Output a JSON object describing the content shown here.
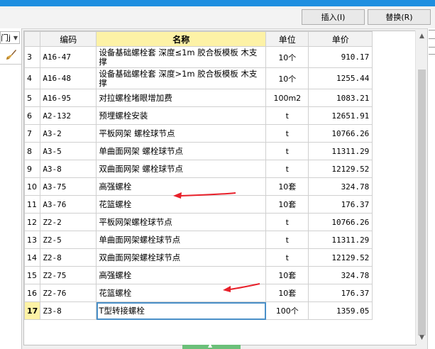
{
  "toolbar": {
    "insert_label": "插入(I)",
    "replace_label": "替换(R)"
  },
  "left_panel": {
    "combo_text": "门j"
  },
  "table": {
    "headers": {
      "row_num": "",
      "code": "编码",
      "name": "名称",
      "unit": "单位",
      "price": "单价"
    },
    "rows": [
      {
        "n": "3",
        "code": "A16-47",
        "name": "设备基础螺栓套 深度≤1m 胶合板模板 木支撑",
        "unit": "10个",
        "price": "910.17"
      },
      {
        "n": "4",
        "code": "A16-48",
        "name": "设备基础螺栓套 深度>1m 胶合板模板 木支撑",
        "unit": "10个",
        "price": "1255.44"
      },
      {
        "n": "5",
        "code": "A16-95",
        "name": "对拉螺栓堵眼增加费",
        "unit": "100m2",
        "price": "1083.21"
      },
      {
        "n": "6",
        "code": "A2-132",
        "name": "预埋螺栓安装",
        "unit": "t",
        "price": "12651.91"
      },
      {
        "n": "7",
        "code": "A3-2",
        "name": "平板网架 螺栓球节点",
        "unit": "t",
        "price": "10766.26"
      },
      {
        "n": "8",
        "code": "A3-5",
        "name": "单曲面网架 螺栓球节点",
        "unit": "t",
        "price": "11311.29"
      },
      {
        "n": "9",
        "code": "A3-8",
        "name": "双曲面网架 螺栓球节点",
        "unit": "t",
        "price": "12129.52"
      },
      {
        "n": "10",
        "code": "A3-75",
        "name": "高强螺栓",
        "unit": "10套",
        "price": "324.78"
      },
      {
        "n": "11",
        "code": "A3-76",
        "name": "花篮螺栓",
        "unit": "10套",
        "price": "176.37"
      },
      {
        "n": "12",
        "code": "Z2-2",
        "name": "平板网架螺栓球节点",
        "unit": "t",
        "price": "10766.26"
      },
      {
        "n": "13",
        "code": "Z2-5",
        "name": "单曲面网架螺栓球节点",
        "unit": "t",
        "price": "11311.29"
      },
      {
        "n": "14",
        "code": "Z2-8",
        "name": "双曲面网架螺栓球节点",
        "unit": "t",
        "price": "12129.52"
      },
      {
        "n": "15",
        "code": "Z2-75",
        "name": "高强螺栓",
        "unit": "10套",
        "price": "324.78"
      },
      {
        "n": "16",
        "code": "Z2-76",
        "name": "花篮螺栓",
        "unit": "10套",
        "price": "176.37"
      },
      {
        "n": "17",
        "code": "Z3-8",
        "name": "T型转接螺栓",
        "unit": "100个",
        "price": "1359.05"
      }
    ]
  },
  "colors": {
    "title_bar": "#1e8fe0",
    "header_highlight": "#fdf2a6",
    "arrow": "#e8202a",
    "bottom_tab": "#6cc07a"
  },
  "icons": [
    "brush-icon",
    "chevron-up-icon",
    "chevron-down-icon",
    "dropdown-arrow-icon"
  ]
}
